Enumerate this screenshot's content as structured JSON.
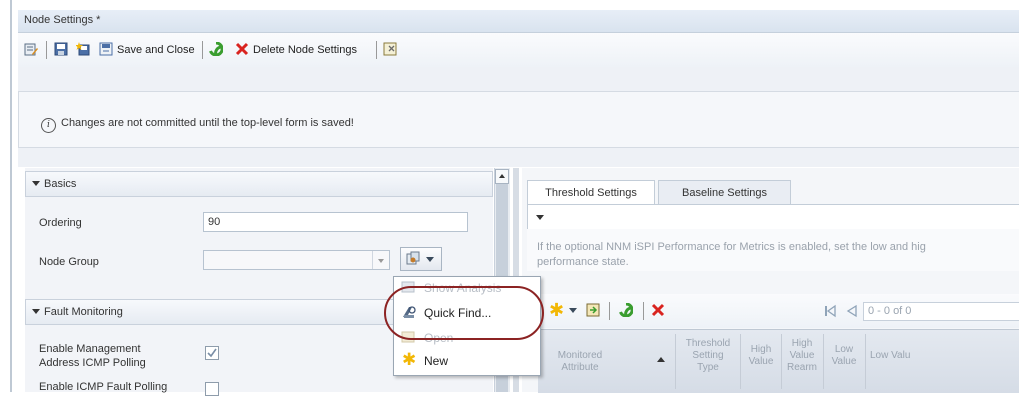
{
  "window": {
    "title": "Node Settings *"
  },
  "toolbar": {
    "save_close_label": "Save and Close",
    "delete_label": "Delete Node Settings"
  },
  "message": {
    "text": "Changes are not committed until the top-level form is saved!"
  },
  "basics": {
    "header": "Basics",
    "ordering_label": "Ordering",
    "ordering_value": "90",
    "node_group_label": "Node Group",
    "node_group_value": ""
  },
  "fault": {
    "header": "Fault Monitoring",
    "enable_mgmt_label_1": "Enable Management",
    "enable_mgmt_label_2": "Address ICMP Polling",
    "enable_mgmt_checked": true,
    "enable_fault_label": "Enable ICMP Fault Polling"
  },
  "right_panel": {
    "tabs": [
      "Threshold Settings",
      "Baseline Settings"
    ],
    "info_line_1": "If the optional NNM iSPI Performance for Metrics is enabled, set the low and hig",
    "info_line_2": "performance state.",
    "paging": "0 - 0 of 0",
    "columns": {
      "monitored": [
        "Monitored",
        "Attribute"
      ],
      "threshold_type": [
        "Threshold",
        "Setting",
        "Type"
      ],
      "high_value": [
        "High",
        "Value"
      ],
      "high_rearm": [
        "High",
        "Value",
        "Rearm"
      ],
      "low_value": [
        "Low",
        "Value"
      ],
      "low_value2": "Low Valu"
    }
  },
  "dropdown_menu": {
    "items": [
      "Show Analysis",
      "Quick Find...",
      "Open",
      "New"
    ]
  },
  "colors": {
    "highlight": "#8c2323",
    "accent": "#3a9d2f",
    "delete": "#d9231f"
  }
}
